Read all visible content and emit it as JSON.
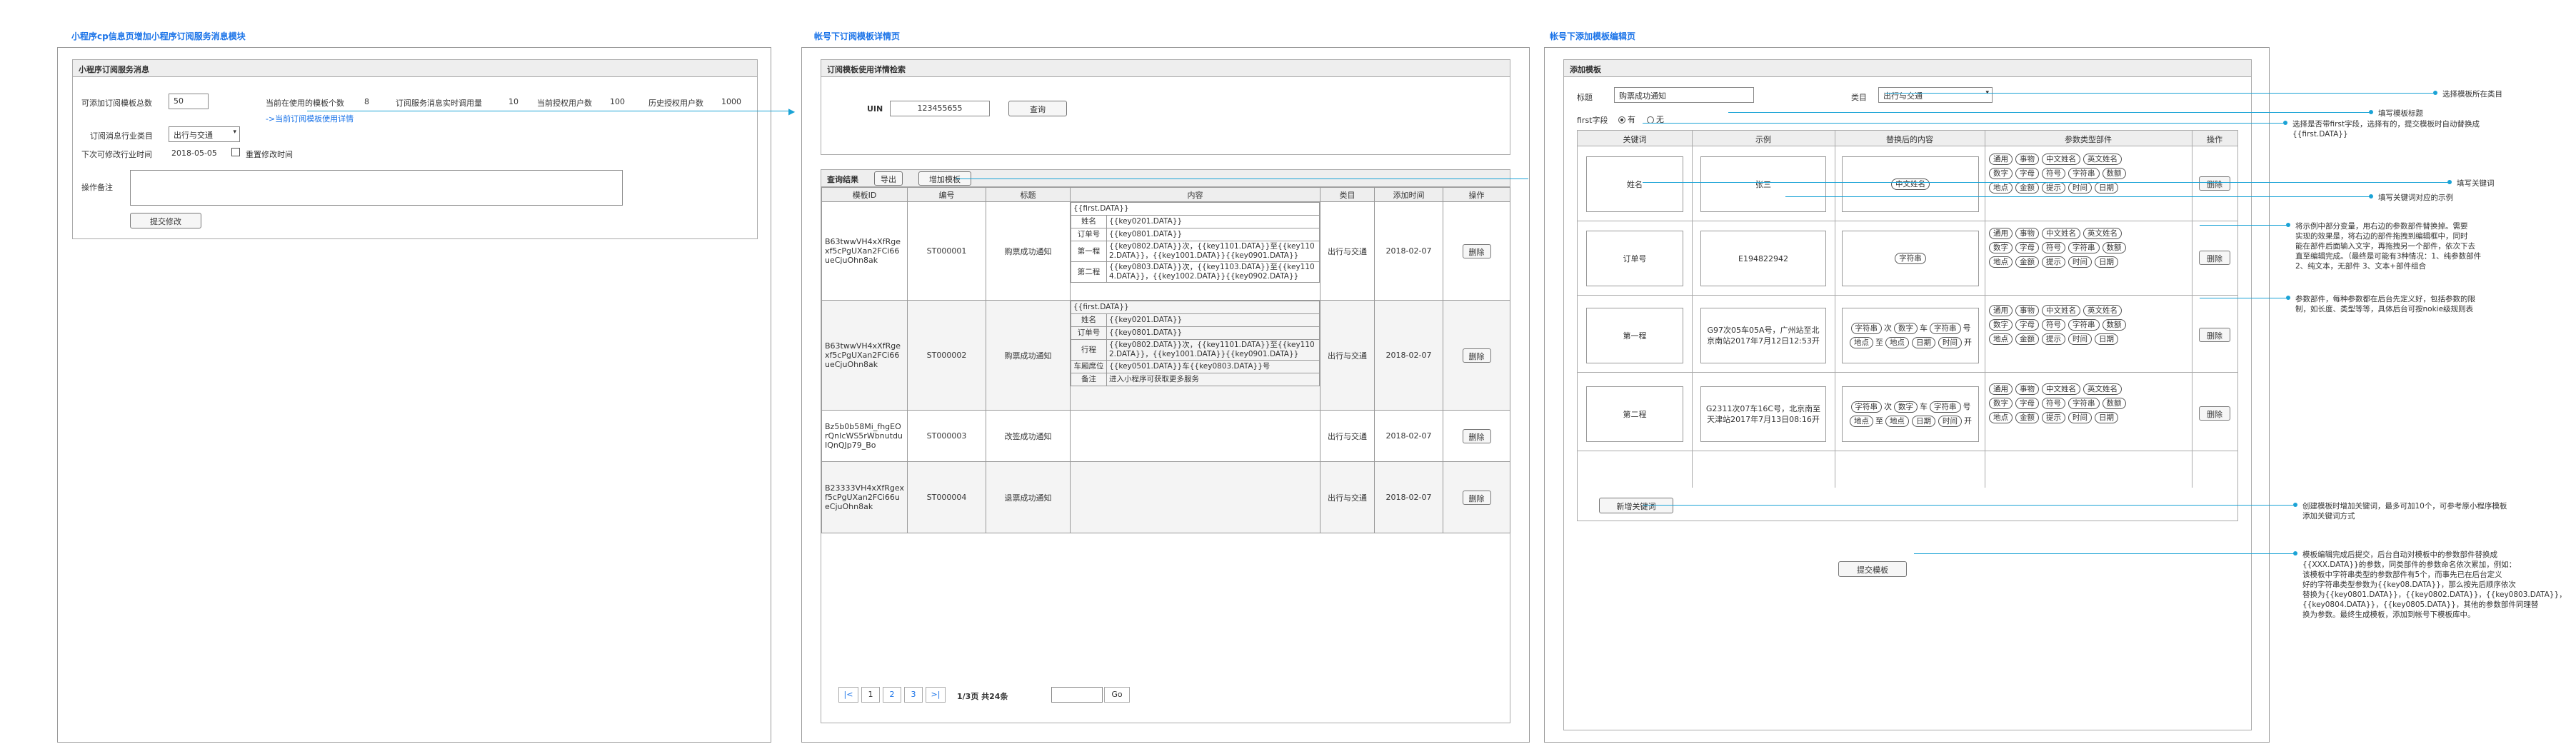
{
  "page1": {
    "title": "小程序cp信息页增加小程序订阅服务消息模块",
    "section_title": "小程序订阅服务消息",
    "max_templates_label": "可添加订阅模板总数",
    "max_templates_value": "50",
    "in_use_label": "当前在使用的模板个数",
    "in_use_value": "8",
    "realtime_calls_label": "订阅服务消息实时调用量",
    "realtime_calls_value": "10",
    "auth_users_label": "当前授权用户数",
    "auth_users_value": "100",
    "hist_users_label": "历史授权用户数",
    "hist_users_value": "1000",
    "link": "->当前订阅模板使用详情",
    "industry_label": "订阅消息行业类目",
    "industry_value": "出行与交通",
    "next_change_label": "下次可修改行业时间",
    "next_change_value": "2018-05-05",
    "reset_label": "重置修改时间",
    "remark_label": "操作备注",
    "submit": "提交修改"
  },
  "page2": {
    "title": "帐号下订阅模板详情页",
    "search_title": "订阅模板使用详情检索",
    "uin_label": "UIN",
    "uin_value": "123455655",
    "query_btn": "查询",
    "result_label": "查询结果",
    "export_btn": "导出",
    "add_btn": "增加模板",
    "columns": [
      "模板ID",
      "编号",
      "标题",
      "内容",
      "类目",
      "添加时间",
      "操作"
    ],
    "rows": [
      {
        "id": "B63twwVH4xXfRgexf5cPgUXan2FCi66ueCjuOhn8ak",
        "no": "ST000001",
        "title": "购票成功通知",
        "content": [
          [
            "",
            "{{first.DATA}}"
          ],
          [
            "姓名",
            "{{key0201.DATA}}"
          ],
          [
            "订单号",
            "{{key0801.DATA}}"
          ],
          [
            "第一程",
            "{{key0802.DATA}}次，{{key1101.DATA}}至{{key1102.DATA}}，{{key1001.DATA}}{{key0901.DATA}}"
          ],
          [
            "第二程",
            "{{key0803.DATA}}次，{{key1103.DATA}}至{{key1104.DATA}}，{{key1002.DATA}}{{key0902.DATA}}"
          ]
        ],
        "cat": "出行与交通",
        "date": "2018-02-07",
        "op": "删除"
      },
      {
        "id": "B63twwVH4xXfRgexf5cPgUXan2FCi66ueCjuOhn8ak",
        "no": "ST000002",
        "title": "购票成功通知",
        "content": [
          [
            "",
            "{{first.DATA}}"
          ],
          [
            "姓名",
            "{{key0201.DATA}}"
          ],
          [
            "订单号",
            "{{key0801.DATA}}"
          ],
          [
            "行程",
            "{{key0802.DATA}}次，{{key1101.DATA}}至{{key1102.DATA}}，{{key1001.DATA}}{{key0901.DATA}}"
          ],
          [
            "车厢席位",
            "{{key0501.DATA}}车{{key0803.DATA}}号"
          ],
          [
            "备注",
            "进入小程序可获取更多服务"
          ]
        ],
        "cat": "出行与交通",
        "date": "2018-02-07",
        "op": "删除"
      },
      {
        "id": "Bz5b0b58Mi_fhgEOrQnIcWS5rWbnutduIQnQJp79_Bo",
        "no": "ST000003",
        "title": "改签成功通知",
        "content": [],
        "cat": "出行与交通",
        "date": "2018-02-07",
        "op": "删除"
      },
      {
        "id": "B23333VH4xXfRgexf5cPgUXan2FCi66ueCjuOhn8ak",
        "no": "ST000004",
        "title": "退票成功通知",
        "content": [],
        "cat": "出行与交通",
        "date": "2018-02-07",
        "op": "删除"
      }
    ],
    "pager": {
      "prev": "|<",
      "p1": "1",
      "p2": "2",
      "p3": "3",
      "next": ">|",
      "info": "1/3页 共24条",
      "go": "Go"
    }
  },
  "page3": {
    "title": "帐号下添加模板编辑页",
    "section_title": "添加模板",
    "title_label": "标题",
    "title_value": "购票成功通知",
    "cat_label": "类目",
    "cat_value": "出行与交通",
    "first_label": "first字段",
    "yes": "有",
    "no": "无",
    "columns": [
      "关键词",
      "示例",
      "替换后的内容",
      "参数类型部件",
      "操作"
    ],
    "params_row": [
      "通用",
      "事物",
      "中文姓名",
      "英文姓名",
      "数字",
      "字母",
      "符号",
      "字符串",
      "数额",
      "地点",
      "金额",
      "提示",
      "时间",
      "日期"
    ],
    "rows": [
      {
        "kw": "姓名",
        "ex": "张三",
        "content": [
          [
            "中文姓名"
          ]
        ],
        "op": "删除"
      },
      {
        "kw": "订单号",
        "ex": "E194822942",
        "content": [
          [
            "字符串"
          ]
        ],
        "op": "删除"
      },
      {
        "kw": "第一程",
        "ex": "G97次05车05A号，广州站至北京南站2017年7月12日12:53开",
        "content": [
          [
            "字符串",
            "次",
            "数字",
            "车",
            "字符串",
            "号"
          ],
          [
            "地点",
            "至",
            "地点",
            "日期",
            "时间",
            "开"
          ]
        ],
        "op": "删除"
      },
      {
        "kw": "第二程",
        "ex": "G2311次07车16C号，北京南至天津站2017年7月13日08:16开",
        "content": [
          [
            "字符串",
            "次",
            "数字",
            "车",
            "字符串",
            "号"
          ],
          [
            "地点",
            "至",
            "地点",
            "日期",
            "时间",
            "开"
          ]
        ],
        "op": "删除"
      }
    ],
    "add_kw_btn": "新增关键词",
    "submit": "提交模板"
  },
  "notes": {
    "n1": "选择模板所在类目",
    "n2": "填写模板标题",
    "n3": [
      "选择是否带first字段，选择有的，提交模板时自动替换成",
      "{{first.DATA}}"
    ],
    "n4": "填写关键词",
    "n5": "填写关键词对应的示例",
    "n6": [
      "将示例中部分变量，用右边的参数部件替换掉。需要",
      "实现的效果是，将右边的部件拖拽到编辑框中，同时",
      "能在部件后面输入文字，再拖拽另一个部件，依次下去",
      "直至编辑完成。（最终是可能有3种情况：1、纯参数部件",
      "2、纯文本，无部件 3、文本+部件组合"
    ],
    "n7": [
      "参数部件，每种参数都在后台先定义好，包括参数的限",
      "制，如长度、类型等等，具体后台可按nokie级规则表"
    ],
    "n8": [
      "创建模板时增加关键词，最多可加10个，可参考原小程序模板",
      "添加关键词方式"
    ],
    "n9": [
      "模板编辑完成后提交，后台自动对模板中的参数部件替换成",
      "{{XXX.DATA}}的参数，同类部件的参数命名依次累加，例如：",
      "该模板中字符串类型的参数部件有5个，而事先已在后台定义",
      "好的字符串类型参数为{{key08.DATA}}，那么按先后顺序依次",
      "替换为{{key0801.DATA}}，{{key0802.DATA}}，{{key0803.DATA}}，",
      "{{key0804.DATA}}，{{key0805.DATA}}，其他的参数部件同理替",
      "换为参数。最终生成模板，添加到帐号下模板库中。"
    ]
  },
  "colors": {
    "accent": "#1a73e8",
    "connector": "#1aa3d6"
  }
}
